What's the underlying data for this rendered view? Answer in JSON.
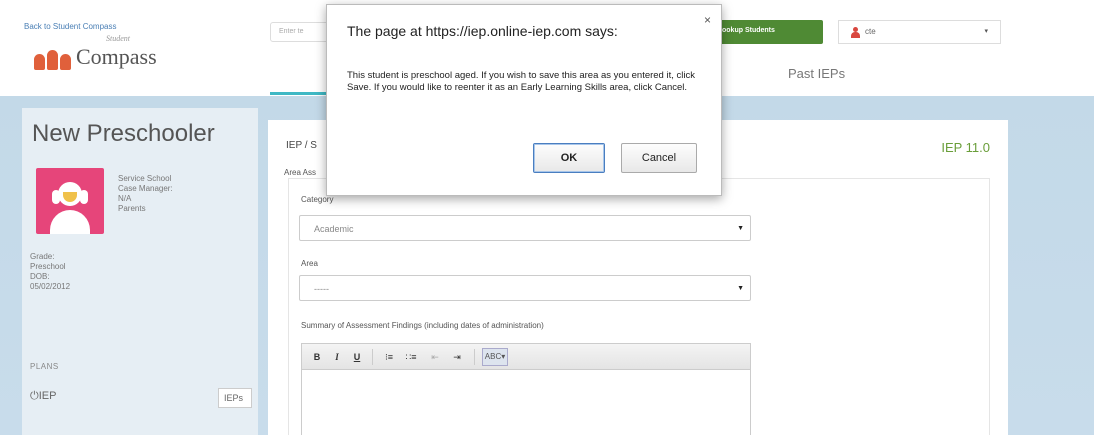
{
  "header": {
    "back_link": "Back to Student Compass",
    "logo_small": "Student",
    "logo_text": "Compass",
    "search_placeholder": "Enter te",
    "lookup_label": "ookup Students",
    "user_name": "cte",
    "user_caret": "▾",
    "tab_past": "Past IEPs"
  },
  "sidebar": {
    "student_name": "New Preschooler",
    "info": [
      "Service School",
      "Case Manager:",
      "N/A",
      "Parents"
    ],
    "grade_label": "Grade:",
    "grade_value": "Preschool",
    "dob_label": "DOB:",
    "dob_value": "05/02/2012",
    "plans_label": "PLANS",
    "iep_label": "IEP",
    "ieps_button": "IEPs"
  },
  "main": {
    "breadcrumb": "IEP / S",
    "iep_version": "IEP 11.0",
    "area_ass": "Area Ass",
    "category_label": "Category",
    "category_value": "Academic",
    "area_label": "Area",
    "area_value": "-----",
    "summary_label": "Summary of Assessment Findings (including dates of administration)",
    "toolbar": {
      "bold": "B",
      "italic": "I",
      "underline": "U",
      "ol": "⁝≡",
      "ul": "∷≡",
      "outdent": "⇤",
      "indent": "⇥",
      "spell": "ABC▾"
    }
  },
  "dialog": {
    "title": "The page at https://iep.online-iep.com says:",
    "close": "×",
    "message": "This student is preschool aged. If you wish to save this area as you entered it, click Save. If you would like to reenter it as an Early Learning Skills area, click Cancel.",
    "ok_label": "OK",
    "cancel_label": "Cancel"
  },
  "colors": {
    "accent_green": "#4f8a34",
    "version_green": "#6a9e3a",
    "avatar_pink": "#e6457a",
    "band_blue": "#c3d9e8",
    "tab_underline": "#3fb8c4"
  }
}
